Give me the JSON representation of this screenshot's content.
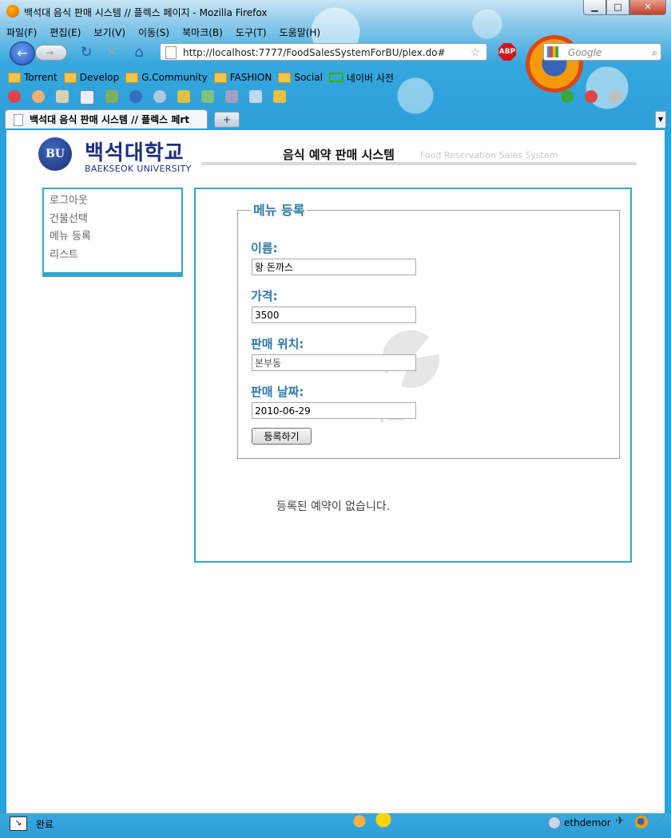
{
  "window": {
    "title": "백석대 음식 판매 시스템 // 플렉스 페이지 - Mozilla Firefox",
    "controls": {
      "minimize": "▁",
      "maximize": "□",
      "close": "✕"
    }
  },
  "menu": [
    "파일(F)",
    "편집(E)",
    "보기(V)",
    "이동(S)",
    "북마크(B)",
    "도구(T)",
    "도움말(H)"
  ],
  "nav": {
    "back_icon": "←",
    "forward_icon": "→",
    "reload_icon": "↻",
    "stop_icon": "✕",
    "home_icon": "⌂",
    "url": "http://localhost:7777/FoodSalesSystemForBU/plex.do#",
    "search_placeholder": "Google",
    "adblock_label": "ABP"
  },
  "bookmarks": [
    "Torrent",
    "Develop",
    "G.Community",
    "FASHION",
    "Social",
    "네이버 사전"
  ],
  "tabs": {
    "active_title": "백석대 음식 판매 시스템 // 플렉스 페rt",
    "new_tab": "+"
  },
  "site": {
    "logo_badge": "BU",
    "logo_korean": "백석대학교",
    "logo_english": "BAEKSEOK UNIVERSITY",
    "title": "음식 예약 판매 시스템",
    "subtitle": "Food Reservation Sales System"
  },
  "sidebar": {
    "items": [
      {
        "label": "로그아웃"
      },
      {
        "label": "건물선택"
      },
      {
        "label": "메뉴 등록"
      },
      {
        "label": "리스트"
      }
    ]
  },
  "form": {
    "legend": "메뉴 등록",
    "watermark_text": "학교",
    "fields": [
      {
        "label": "이름:",
        "value": "왕 돈까스",
        "placeholder": ""
      },
      {
        "label": "가격:",
        "value": "3500",
        "placeholder": ""
      },
      {
        "label": "판매 위치:",
        "value": "",
        "placeholder": "본부동"
      },
      {
        "label": "판매 날짜:",
        "value": "2010-06-29",
        "placeholder": ""
      }
    ],
    "submit_label": "등록하기"
  },
  "empty_message": "등록된 예약이 없습니다.",
  "status": {
    "text": "완료",
    "user": "ethdemor"
  }
}
